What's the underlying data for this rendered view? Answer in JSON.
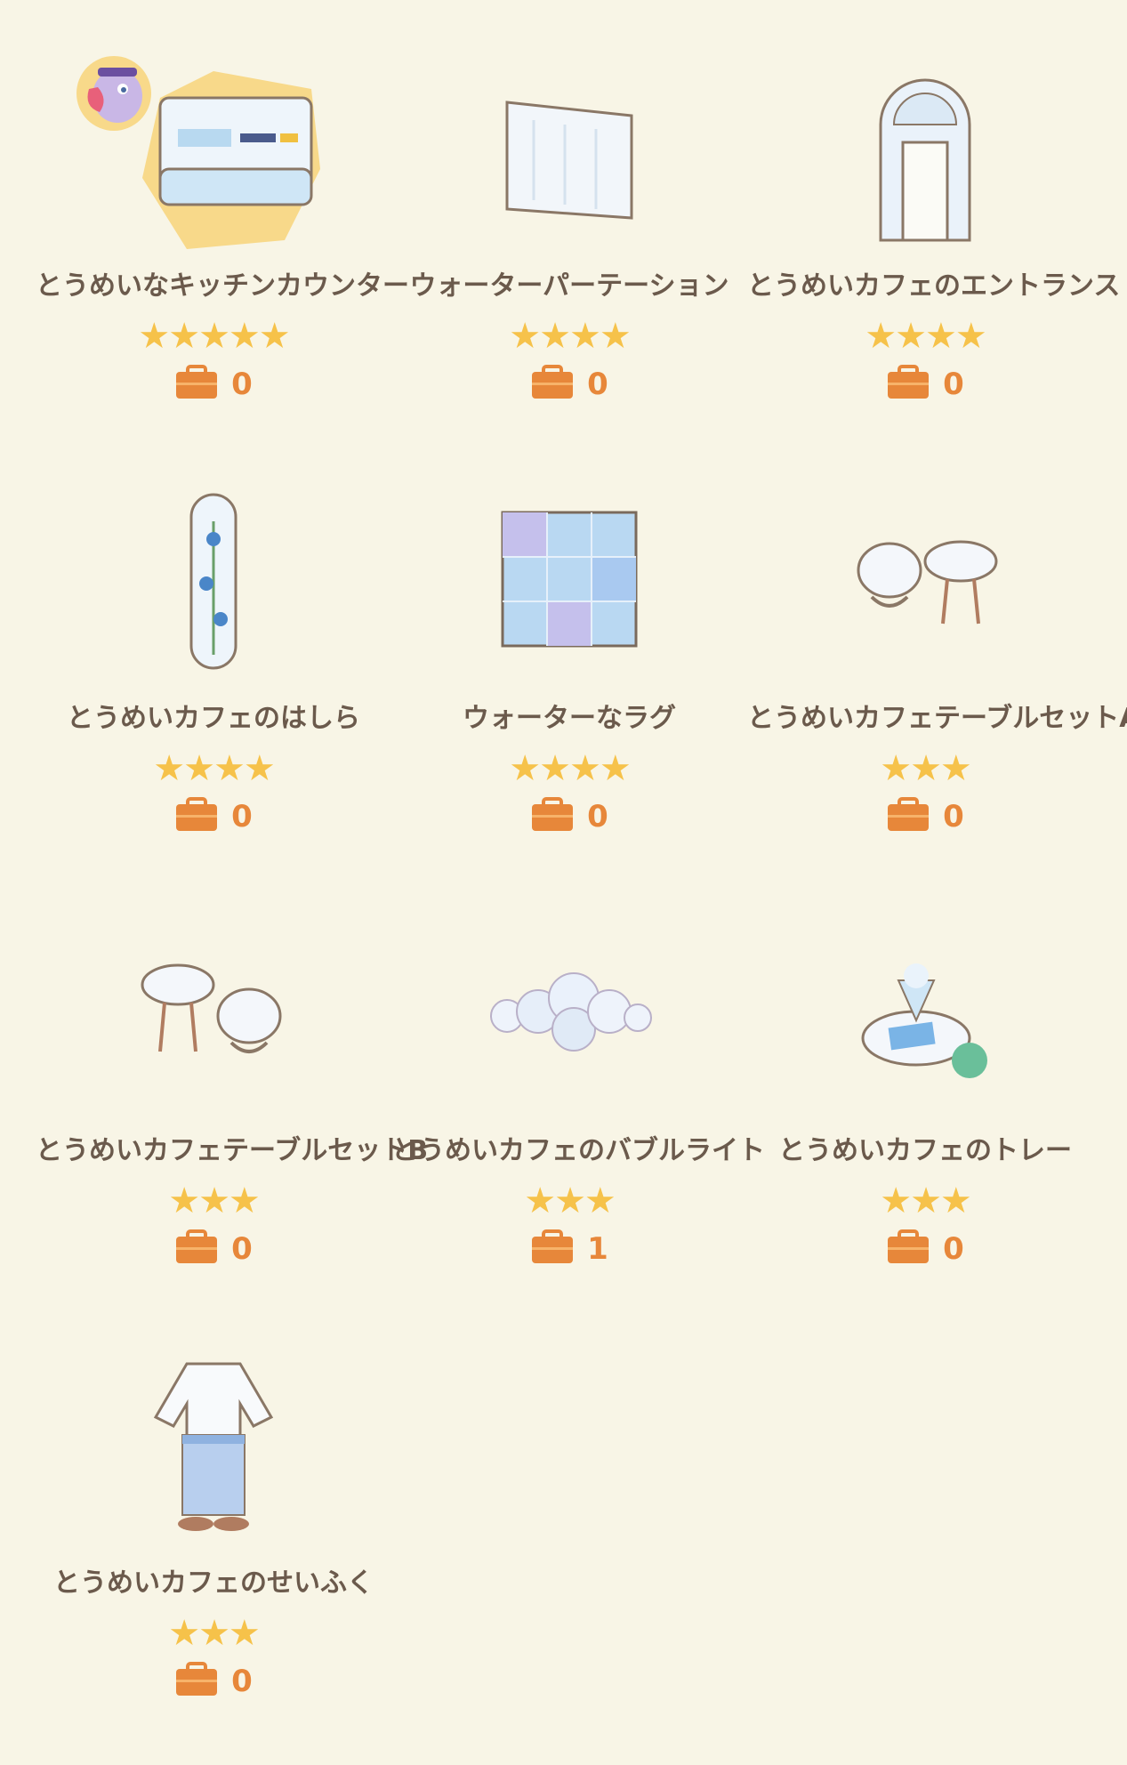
{
  "colors": {
    "background": "#f8f5e6",
    "star": "#f6c24a",
    "count": "#e7873a",
    "text": "#6b5a4c"
  },
  "items": [
    {
      "name": "とうめいなキッチンカウンター",
      "stars": "★★★★★",
      "count": "0",
      "icon": "kitchen-counter-icon"
    },
    {
      "name": "ウォーターパーテーション",
      "stars": "★★★★",
      "count": "0",
      "icon": "water-partition-icon"
    },
    {
      "name": "とうめいカフェのエントランス",
      "stars": "★★★★",
      "count": "0",
      "icon": "cafe-entrance-icon"
    },
    {
      "name": "とうめいカフェのはしら",
      "stars": "★★★★",
      "count": "0",
      "icon": "cafe-pillar-icon"
    },
    {
      "name": "ウォーターなラグ",
      "stars": "★★★★",
      "count": "0",
      "icon": "water-rug-icon"
    },
    {
      "name": "とうめいカフェテーブルセットA",
      "stars": "★★★",
      "count": "0",
      "icon": "table-set-a-icon"
    },
    {
      "name": "とうめいカフェテーブルセットB",
      "stars": "★★★",
      "count": "0",
      "icon": "table-set-b-icon"
    },
    {
      "name": "とうめいカフェのバブルライト",
      "stars": "★★★",
      "count": "1",
      "icon": "bubble-light-icon"
    },
    {
      "name": "とうめいカフェのトレー",
      "stars": "★★★",
      "count": "0",
      "icon": "cafe-tray-icon"
    },
    {
      "name": "とうめいカフェのせいふく",
      "stars": "★★★",
      "count": "0",
      "icon": "cafe-uniform-icon"
    }
  ]
}
